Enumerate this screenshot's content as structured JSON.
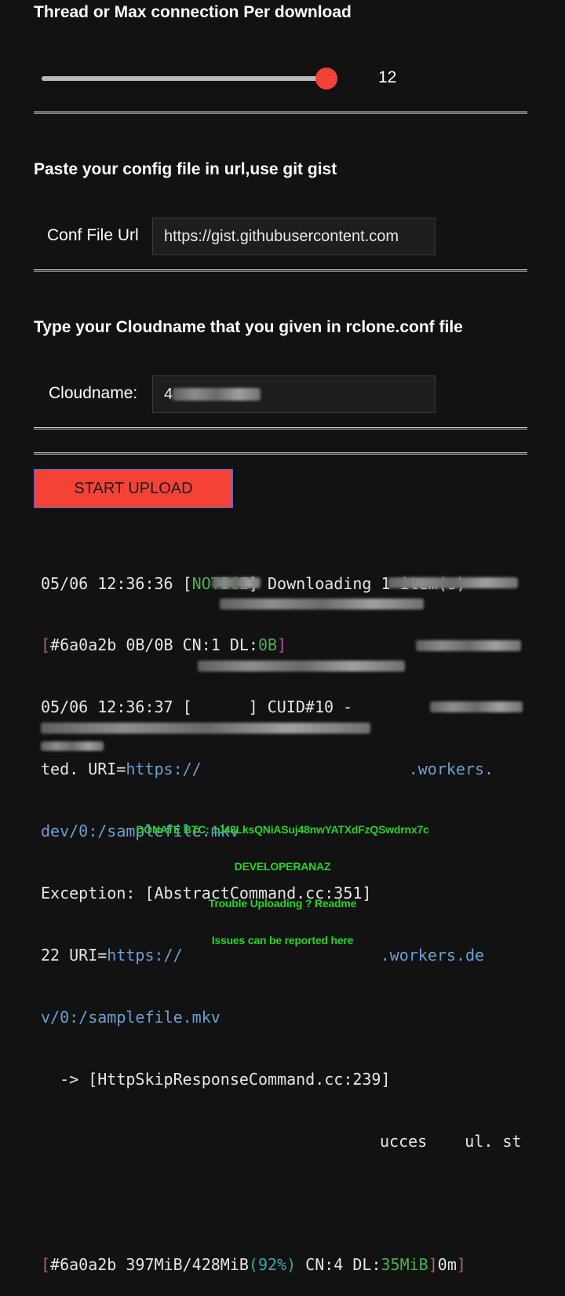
{
  "thread_section": {
    "title": "Thread or Max connection Per download",
    "slider_value": "12",
    "slider_fraction": 0.97
  },
  "config_section": {
    "title": "Paste your config file in url,use git gist",
    "label": "Conf File Url",
    "value": "https://gist.githubusercontent.com"
  },
  "cloudname_section": {
    "title": "Type your Cloudname that you given in rclone.conf file",
    "label": "Cloudname:",
    "value_visible": "4"
  },
  "start_button_label": "START UPLOAD",
  "log": {
    "l1_a": "05/06 12:36:36 [",
    "l1_notice": "NOTICE",
    "l1_b": "] Downloading 1 item(s)",
    "l2_a": "[",
    "l2_b": "#6a0a2b 0B/0B CN:1 DL:",
    "l2_dl": "0B",
    "l2_c": "]",
    "l3_a": "05/06 12:36:37 [",
    "l3_b": "] CUID#10 - ",
    "l4_a": "ted. URI=",
    "l4_uri": "https://",
    "l4_end": ".workers.",
    "l5": "dev/0:/samplefile.mkv",
    "l6": "Exception: [AbstractCommand.cc:351] ",
    "l7_a": "22 URI=",
    "l7_uri": "https://",
    "l7_end": ".workers.de",
    "l8": "v/0:/samplefile.mkv",
    "l9": "  -> [HttpSkipResponseCommand.cc:239] ",
    "l10_a": "ucces",
    "l10_b": " ul. st",
    "l12_a": "[",
    "l12_b": "#6a0a2b 397MiB/428MiB",
    "l12_pct": "(92%)",
    "l12_c": " CN:4 DL:",
    "l12_dl": "35MiB",
    "l12_d": "]",
    "l12_e": "0m",
    "l12_f": "]"
  },
  "footer": {
    "donate": "DONATE BTC: 1J48LksQNiASuj48nwYATXdFzQSwdrnx7c",
    "developer": "DEVELOPERANAZ",
    "readme": "Trouble Uploading ? Readme",
    "issues": "Issues can be reported here"
  },
  "colors": {
    "background": "#121212",
    "accent_red": "#f44336",
    "notice_green": "#4caf50",
    "log_magenta": "#b5579b",
    "log_blue": "#6c9fd4",
    "footer_green": "#27d427"
  }
}
